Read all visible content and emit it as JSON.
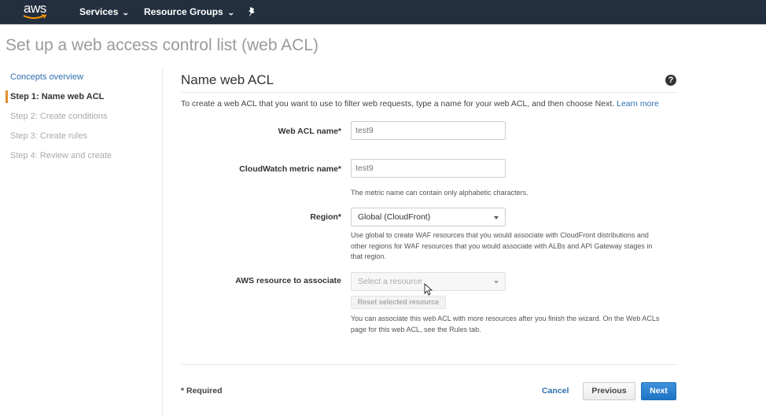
{
  "topbar": {
    "logo_text": "aws",
    "services_label": "Services",
    "resource_groups_label": "Resource Groups",
    "pin_icon": "pushpin-icon"
  },
  "page": {
    "title": "Set up a web access control list (web ACL)"
  },
  "sidebar": {
    "items": [
      {
        "label": "Concepts overview",
        "state": "link"
      },
      {
        "label": "Step 1: Name web ACL",
        "state": "active"
      },
      {
        "label": "Step 2: Create conditions",
        "state": "disabled"
      },
      {
        "label": "Step 3: Create rules",
        "state": "disabled"
      },
      {
        "label": "Step 4: Review and create",
        "state": "disabled"
      }
    ],
    "active_marker_color": "#e38d2c"
  },
  "main": {
    "title": "Name web ACL",
    "help_icon": "?",
    "intro_text": "To create a web ACL that you want to use to filter web requests, type a name for your web ACL, and then choose Next.",
    "learn_more": "Learn more",
    "fields": {
      "web_acl_name": {
        "label": "Web ACL name*",
        "value": "test9"
      },
      "metric_name": {
        "label": "CloudWatch metric name*",
        "value": "test9",
        "hint": "The metric name can contain only alphabetic characters."
      },
      "region": {
        "label": "Region*",
        "value": "Global (CloudFront)",
        "hint": "Use global to create WAF resources that you would associate with CloudFront distributions and other regions for WAF resources that you would associate with ALBs and API Gateway stages in that region."
      },
      "resource": {
        "label": "AWS resource to associate",
        "placeholder": "Select a resource",
        "reset_label": "Reset selected resource",
        "hint": "You can associate this web ACL with more resources after you finish the wizard. On the Web ACLs page for this web ACL, see the Rules tab."
      }
    }
  },
  "footer": {
    "required_note": "* Required",
    "cancel_label": "Cancel",
    "previous_label": "Previous",
    "next_label": "Next"
  },
  "colors": {
    "topbar_bg": "#232f3e",
    "link": "#2f6fb0",
    "primary_button": "#1e73c4"
  }
}
